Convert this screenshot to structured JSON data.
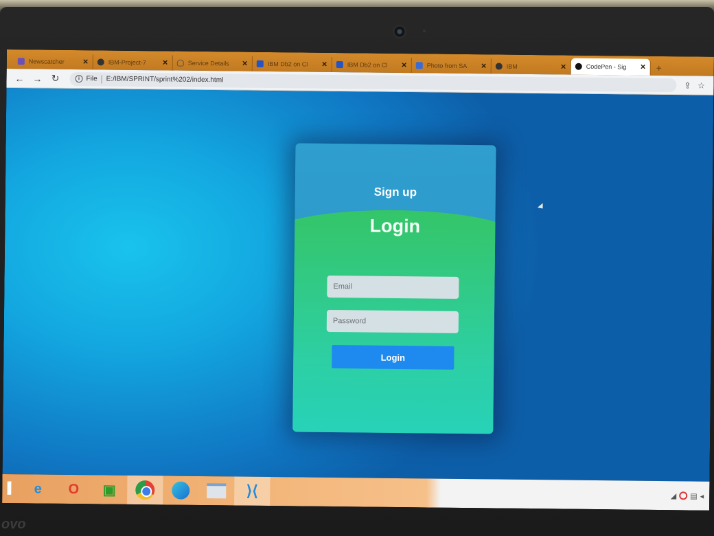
{
  "browser": {
    "tabs": [
      {
        "title": "Newscatcher",
        "icon": "newscatcher-icon",
        "color": "#6b4fbb"
      },
      {
        "title": "IBM-Project-7",
        "icon": "github-icon",
        "color": "#333333"
      },
      {
        "title": "Service Details",
        "icon": "cloud-icon",
        "color": "#555555"
      },
      {
        "title": "IBM Db2 on Cl",
        "icon": "ibm-grid-icon",
        "color": "#2455c3"
      },
      {
        "title": "IBM Db2 on Cl",
        "icon": "ibm-grid-icon",
        "color": "#2455c3"
      },
      {
        "title": "Photo from SA",
        "icon": "photo-icon",
        "color": "#3b6bd6"
      },
      {
        "title": "IBM",
        "icon": "github-icon",
        "color": "#333333"
      },
      {
        "title": "CodePen - Sig",
        "icon": "codepen-icon",
        "color": "#111111",
        "active": true
      }
    ],
    "new_tab": "+",
    "address": {
      "scheme_label": "File",
      "url": "E:/IBM/SPRINT/sprint%202/index.html"
    }
  },
  "page": {
    "signup_label": "Sign up",
    "login_title": "Login",
    "email_placeholder": "Email",
    "password_placeholder": "Password",
    "login_button": "Login"
  },
  "taskbar": {
    "apps": [
      "internet-explorer-icon",
      "opera-icon",
      "store-icon",
      "chrome-icon",
      "edge-icon",
      "file-explorer-icon",
      "vscode-icon"
    ]
  },
  "device": {
    "brand": "Lenovo"
  }
}
